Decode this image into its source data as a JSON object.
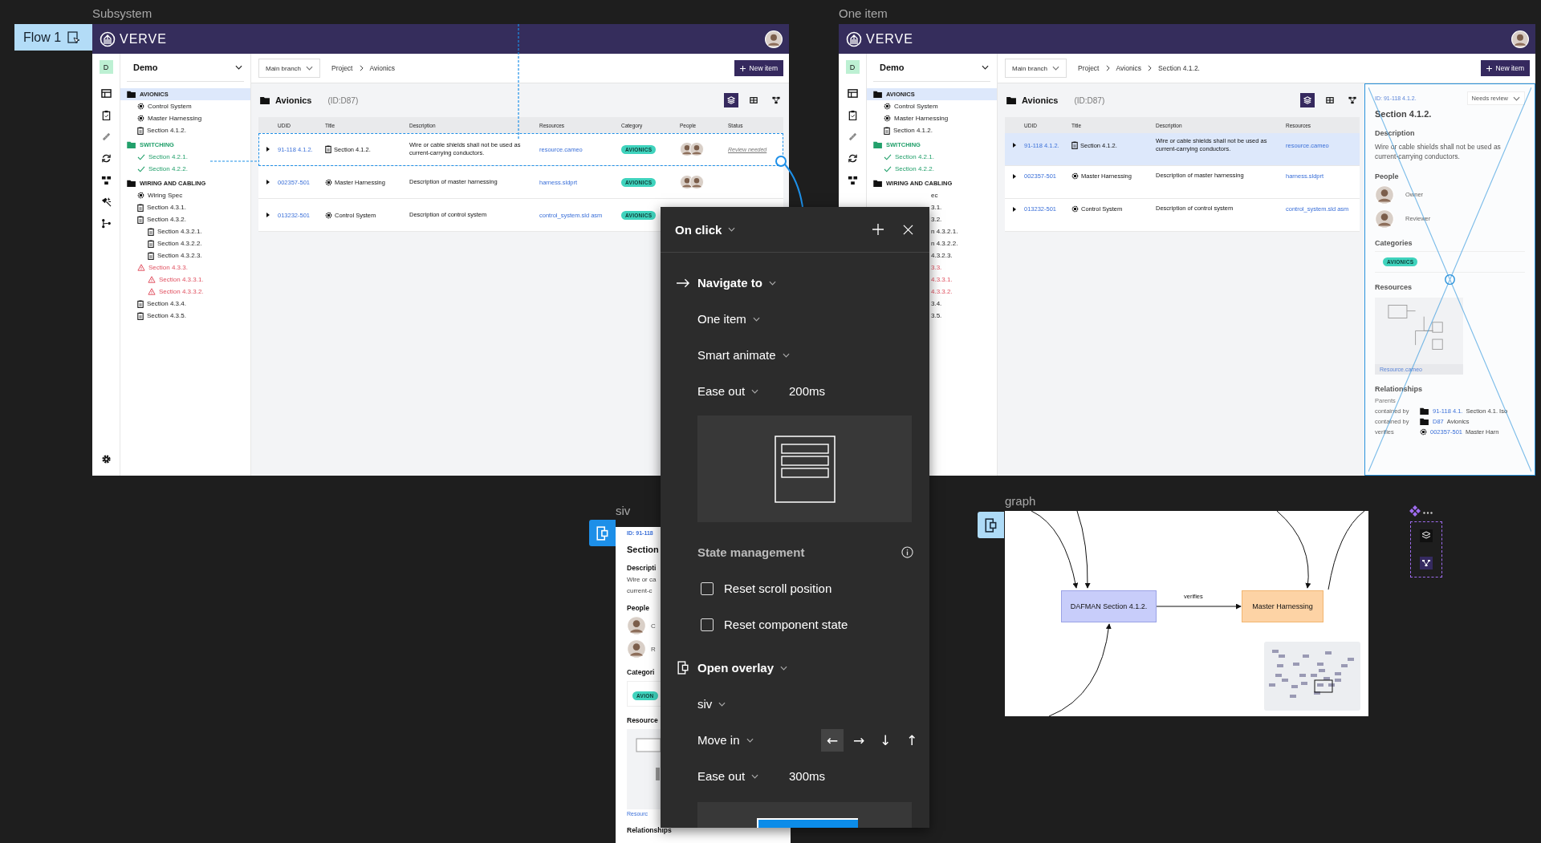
{
  "flow_badge": {
    "label": "Flow 1"
  },
  "frames": [
    {
      "name": "Subsystem",
      "brand": "VERVE",
      "project_initial": "D",
      "project": "Demo",
      "branch": "Main branch",
      "breadcrumb": [
        "Project",
        "Avionics"
      ],
      "new_item": "New item",
      "folder_title": "Avionics",
      "folder_id": "(ID:D87)",
      "views": [
        {
          "kind": "layers",
          "selected": true
        },
        {
          "kind": "table",
          "selected": false
        },
        {
          "kind": "graph",
          "selected": false
        }
      ],
      "tree": [
        {
          "label": "AVIONICS",
          "kind": "folder",
          "selected": true,
          "children": [
            {
              "label": "Control System",
              "kind": "part",
              "selected": false
            },
            {
              "label": "Master Harnessing",
              "kind": "part",
              "selected": false
            },
            {
              "label": "Section 4.1.2.",
              "kind": "doc",
              "selected": false
            }
          ]
        },
        {
          "label": "SWITCHING",
          "kind": "folder-ok",
          "selected": false,
          "children": [
            {
              "label": "Section 4.2.1.",
              "kind": "doc-ok",
              "selected": false
            },
            {
              "label": "Section 4.2.2.",
              "kind": "doc-ok",
              "selected": false
            }
          ]
        },
        {
          "label": "WIRING AND CABLING",
          "kind": "folder",
          "selected": false,
          "children": [
            {
              "label": "Wiring Spec",
              "kind": "part",
              "selected": false
            },
            {
              "label": "Section 4.3.1.",
              "kind": "doc",
              "selected": false
            },
            {
              "label": "Section 4.3.2.",
              "kind": "doc",
              "selected": false,
              "children": [
                {
                  "label": "Section 4.3.2.1.",
                  "kind": "doc",
                  "selected": false
                },
                {
                  "label": "Section 4.3.2.2.",
                  "kind": "doc",
                  "selected": false
                },
                {
                  "label": "Section 4.3.2.3.",
                  "kind": "doc",
                  "selected": false
                }
              ]
            },
            {
              "label": "Section 4.3.3.",
              "kind": "doc-warn",
              "selected": false,
              "children": [
                {
                  "label": "Section 4.3.3.1.",
                  "kind": "doc-warn",
                  "selected": false
                },
                {
                  "label": "Section 4.3.3.2.",
                  "kind": "doc-warn",
                  "selected": false
                }
              ]
            },
            {
              "label": "Section 4.3.4.",
              "kind": "doc",
              "selected": false
            },
            {
              "label": "Section 4.3.5.",
              "kind": "doc",
              "selected": false
            }
          ]
        }
      ],
      "columns": [
        "UDID",
        "Title",
        "Description",
        "Resources",
        "Category",
        "People",
        "Status"
      ],
      "rows": [
        {
          "udid": "91-118 4.1.2.",
          "kind": "doc",
          "title": "Section 4.1.2.",
          "description": "Wire or cable shields shall not be used as current-carrying conductors.",
          "resource": "resource.cameo",
          "category": "AVIONICS",
          "status": "Review needed",
          "selected": false,
          "hotspot": true
        },
        {
          "udid": "002357-501",
          "kind": "part",
          "title": "Master Harnessing",
          "description": "Description of master harnessing",
          "resource": "harness.sldprt",
          "category": "AVIONICS",
          "selected": false,
          "hotspot": false
        },
        {
          "udid": "013232-501",
          "kind": "part",
          "title": "Control System",
          "description": "Description of control system",
          "resource": "control_system.sld asm",
          "category": "AVIONICS",
          "selected": false,
          "hotspot": false
        }
      ]
    },
    {
      "name": "One item",
      "brand": "VERVE",
      "project_initial": "D",
      "project": "Demo",
      "branch": "Main branch",
      "breadcrumb": [
        "Project",
        "Avionics",
        "Section 4.1.2."
      ],
      "new_item": "New item",
      "folder_title": "Avionics",
      "folder_id": "(ID:D87)",
      "views": [
        {
          "kind": "layers",
          "selected": true
        },
        {
          "kind": "table",
          "selected": false
        },
        {
          "kind": "graph",
          "selected": false
        }
      ],
      "tree": [
        {
          "label": "AVIONICS",
          "kind": "folder",
          "selected": true,
          "children": [
            {
              "label": "Control System",
              "kind": "part",
              "selected": false
            },
            {
              "label": "Master Harnessing",
              "kind": "part",
              "selected": false
            },
            {
              "label": "Section 4.1.2.",
              "kind": "doc",
              "selected": false
            }
          ]
        },
        {
          "label": "SWITCHING",
          "kind": "folder-ok",
          "selected": false,
          "children": [
            {
              "label": "Section 4.2.1.",
              "kind": "doc-ok",
              "selected": false
            },
            {
              "label": "Section 4.2.2.",
              "kind": "doc-ok",
              "selected": false
            }
          ]
        },
        {
          "label": "WIRING AND CABLING",
          "kind": "folder",
          "selected": false,
          "children": [
            {
              "label": "ec",
              "kind": "fragment",
              "selected": false
            },
            {
              "label": "3.1.",
              "kind": "fragment",
              "selected": false
            },
            {
              "label": "3.2.",
              "kind": "fragment",
              "selected": false
            },
            {
              "label": "n 4.3.2.1.",
              "kind": "fragment",
              "selected": false
            },
            {
              "label": "n 4.3.2.2.",
              "kind": "fragment",
              "selected": false
            },
            {
              "label": "4.3.2.3.",
              "kind": "fragment",
              "selected": false
            },
            {
              "label": "3.3.",
              "kind": "fragment-warn",
              "selected": false
            },
            {
              "label": "4.3.3.1.",
              "kind": "fragment-warn",
              "selected": false
            },
            {
              "label": "4.3.3.2.",
              "kind": "fragment-warn",
              "selected": false
            },
            {
              "label": "3.4.",
              "kind": "fragment",
              "selected": false
            },
            {
              "label": "3.5.",
              "kind": "fragment",
              "selected": false
            }
          ]
        }
      ],
      "columns": [
        "UDID",
        "Title",
        "Description",
        "Resources"
      ],
      "rows": [
        {
          "udid": "91-118 4.1.2.",
          "kind": "doc",
          "title": "Section 4.1.2.",
          "description": "Wire or cable shields shall not be used as current-carrying conductors.",
          "resource": "resource.cameo",
          "selected": true,
          "hotspot": false
        },
        {
          "udid": "002357-501",
          "kind": "part",
          "title": "Master Harnessing",
          "description": "Description of master harnessing",
          "resource": "harness.sldprt",
          "selected": false,
          "hotspot": false
        },
        {
          "udid": "013232-501",
          "kind": "part",
          "title": "Control System",
          "description": "Description of control system",
          "resource": "control_system.sld asm",
          "selected": false,
          "hotspot": false
        }
      ],
      "detail": {
        "id": "ID: 91-118 4.1.2.",
        "status": "Needs review",
        "title": "Section 4.1.2.",
        "description_heading": "Description",
        "description": "Wire or cable shields shall not be used as current-carrying conductors.",
        "people_heading": "People",
        "people": [
          {
            "role": "Owner"
          },
          {
            "role": "Reviewer"
          }
        ],
        "categories_heading": "Categories",
        "category": "AVIONICS",
        "resources_heading": "Resources",
        "resource": "Resource.cameo",
        "relationships_heading": "Relationships",
        "parents": "Parents",
        "relations": [
          {
            "type": "contained by",
            "kind": "folder",
            "id": "91-118 4.1.",
            "title": "Section 4.1. Iso"
          },
          {
            "type": "contained by",
            "kind": "folder",
            "id": "D87",
            "title": "Avionics"
          },
          {
            "type": "verifies",
            "kind": "part",
            "id": "002357-501",
            "title": "Master Harn"
          }
        ]
      }
    }
  ],
  "siv": {
    "name": "siv",
    "items": [
      {
        "kind": "id",
        "text": "ID: 91-118"
      },
      {
        "kind": "title",
        "text": "Section"
      },
      {
        "kind": "heading",
        "text": "Descripti"
      },
      {
        "kind": "body",
        "text": "Wire or ca"
      },
      {
        "kind": "body",
        "text": "current-c"
      },
      {
        "kind": "heading",
        "text": "People"
      },
      {
        "kind": "person",
        "text": "C"
      },
      {
        "kind": "person",
        "text": "R"
      },
      {
        "kind": "heading",
        "text": "Categori"
      },
      {
        "kind": "badge",
        "text": "AVION"
      },
      {
        "kind": "heading",
        "text": "Resource"
      },
      {
        "kind": "picture"
      },
      {
        "kind": "link",
        "text": "Resourc"
      },
      {
        "kind": "heading",
        "text": "Relationships"
      }
    ]
  },
  "graph": {
    "name": "graph",
    "nodes": [
      {
        "label": "DAFMAN Section 4.1.2.",
        "color": "#c8cdfa"
      },
      {
        "label": "Master Harnessing",
        "color": "#fdd3a5"
      }
    ],
    "edge_label": "verifies"
  },
  "popup": {
    "trigger": "On click",
    "navigate": {
      "label": "Navigate to",
      "destination": "One item",
      "animation": "Smart animate",
      "easing": "Ease out",
      "duration": "200ms"
    },
    "state_heading": "State management",
    "options": [
      {
        "label": "Reset scroll position",
        "checked": false
      },
      {
        "label": "Reset component state",
        "checked": false
      }
    ],
    "overlay": {
      "label": "Open overlay",
      "destination": "siv",
      "animation": "Move in",
      "easing": "Ease out",
      "duration": "300ms",
      "directions": [
        {
          "arrow": "←",
          "selected": true
        },
        {
          "arrow": "→",
          "selected": false
        },
        {
          "arrow": "↓",
          "selected": false
        },
        {
          "arrow": "↑",
          "selected": false
        }
      ]
    }
  }
}
